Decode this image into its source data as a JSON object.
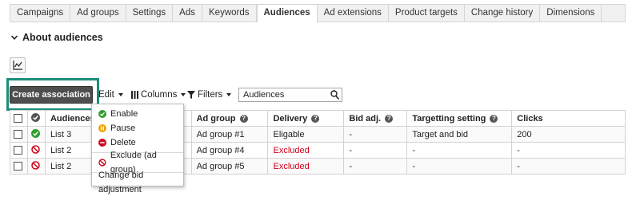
{
  "tabs": [
    "Campaigns",
    "Ad groups",
    "Settings",
    "Ads",
    "Keywords",
    "Audiences",
    "Ad extensions",
    "Product targets",
    "Change history",
    "Dimensions"
  ],
  "active_tab": "Audiences",
  "section": {
    "title": "About audiences",
    "icon": "chevron-down-icon"
  },
  "toolbar": {
    "create_label": "Create association",
    "edit_label": "Edit",
    "columns_label": "Columns",
    "filters_label": "Filters",
    "search_value": "Audiences"
  },
  "colors": {
    "highlight": "#1a8e7a",
    "enabled": "#2e9e2e",
    "paused": "#f0a30a",
    "deleted": "#d0021b",
    "excluded": "#d0021b"
  },
  "table": {
    "headers": {
      "audiences": "Audiences",
      "ad_group": "Ad group",
      "delivery": "Delivery",
      "bid_adj": "Bid adj.",
      "targeting": "Targetting setting",
      "clicks": "Clicks"
    },
    "rows": [
      {
        "status": "enabled",
        "audience": "List 3",
        "ad_group": "Ad group #1",
        "delivery": "Eligable",
        "bid_adj": "-",
        "targeting": "Target and bid",
        "clicks": "200"
      },
      {
        "status": "excluded",
        "audience": "List 2",
        "ad_group": "Ad group #4",
        "delivery": "Excluded",
        "bid_adj": "-",
        "targeting": "-",
        "clicks": "-"
      },
      {
        "status": "excluded",
        "audience": "List 2",
        "ad_group": "Ad group #5",
        "delivery": "Excluded",
        "bid_adj": "-",
        "targeting": "-",
        "clicks": "-"
      }
    ]
  },
  "edit_menu": {
    "enable": "Enable",
    "pause": "Pause",
    "delete": "Delete",
    "exclude": "Exclude (ad group)",
    "change_bid": "Change bid adjustment"
  }
}
